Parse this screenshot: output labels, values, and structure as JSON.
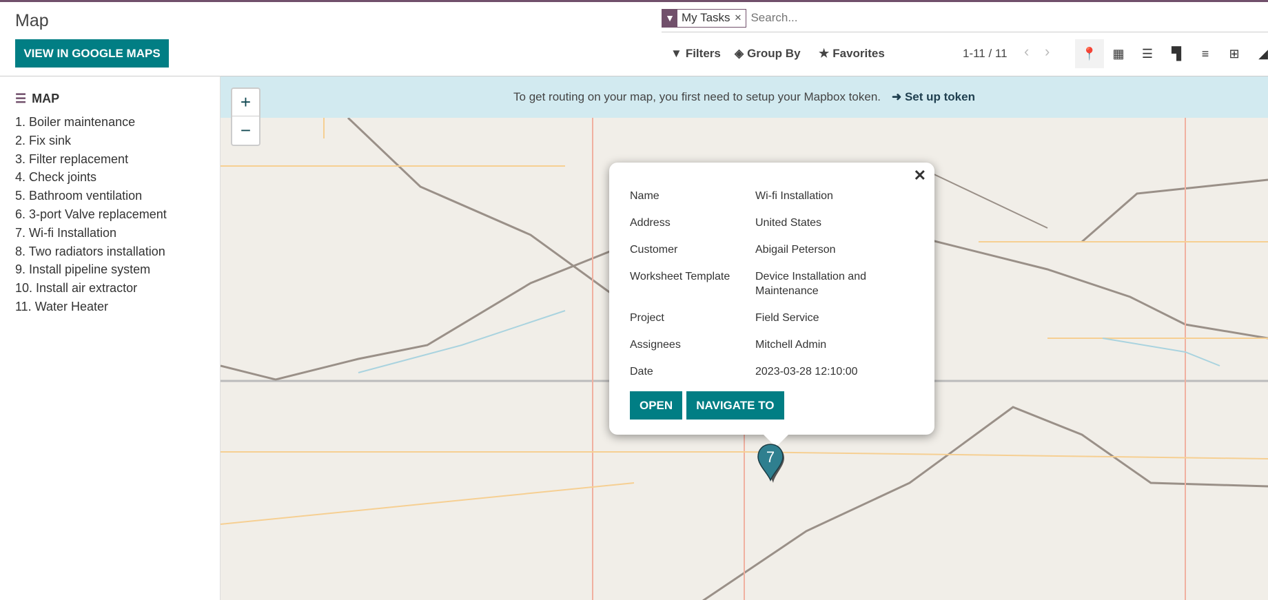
{
  "header": {
    "title": "Map",
    "google_maps_button": "VIEW IN GOOGLE MAPS"
  },
  "search": {
    "facet_icon": "filter-icon",
    "facet_label": "My Tasks",
    "placeholder": "Search..."
  },
  "controls": {
    "filters": "Filters",
    "group_by": "Group By",
    "favorites": "Favorites"
  },
  "pager": {
    "value": "1-11 / 11"
  },
  "views": [
    "map",
    "calendar",
    "gantt",
    "kanban",
    "list",
    "pivot",
    "graph"
  ],
  "active_view": "map",
  "sidebar": {
    "title": "MAP",
    "items": [
      "1. Boiler maintenance",
      "2. Fix sink",
      "3. Filter replacement",
      "4. Check joints",
      "5. Bathroom ventilation",
      "6. 3-port Valve replacement",
      "7. Wi-fi Installation",
      "8. Two radiators installation",
      "9. Install pipeline system",
      "10. Install air extractor",
      "11. Water Heater"
    ]
  },
  "banner": {
    "text": "To get routing on your map, you first need to setup your Mapbox token.",
    "link": "Set up token"
  },
  "zoom": {
    "in": "+",
    "out": "−"
  },
  "popup": {
    "rows": [
      {
        "label": "Name",
        "value": "Wi-fi Installation"
      },
      {
        "label": "Address",
        "value": "United States"
      },
      {
        "label": "Customer",
        "value": "Abigail Peterson"
      },
      {
        "label": "Worksheet Template",
        "value": "Device Installation and Maintenance"
      },
      {
        "label": "Project",
        "value": "Field Service"
      },
      {
        "label": "Assignees",
        "value": "Mitchell Admin"
      },
      {
        "label": "Date",
        "value": "2023-03-28 12:10:00"
      }
    ],
    "open": "OPEN",
    "navigate": "NAVIGATE TO"
  },
  "marker": {
    "number": "7",
    "color": "#2f7f8f"
  },
  "colors": {
    "primary": "#017e84",
    "brand": "#71506b"
  }
}
